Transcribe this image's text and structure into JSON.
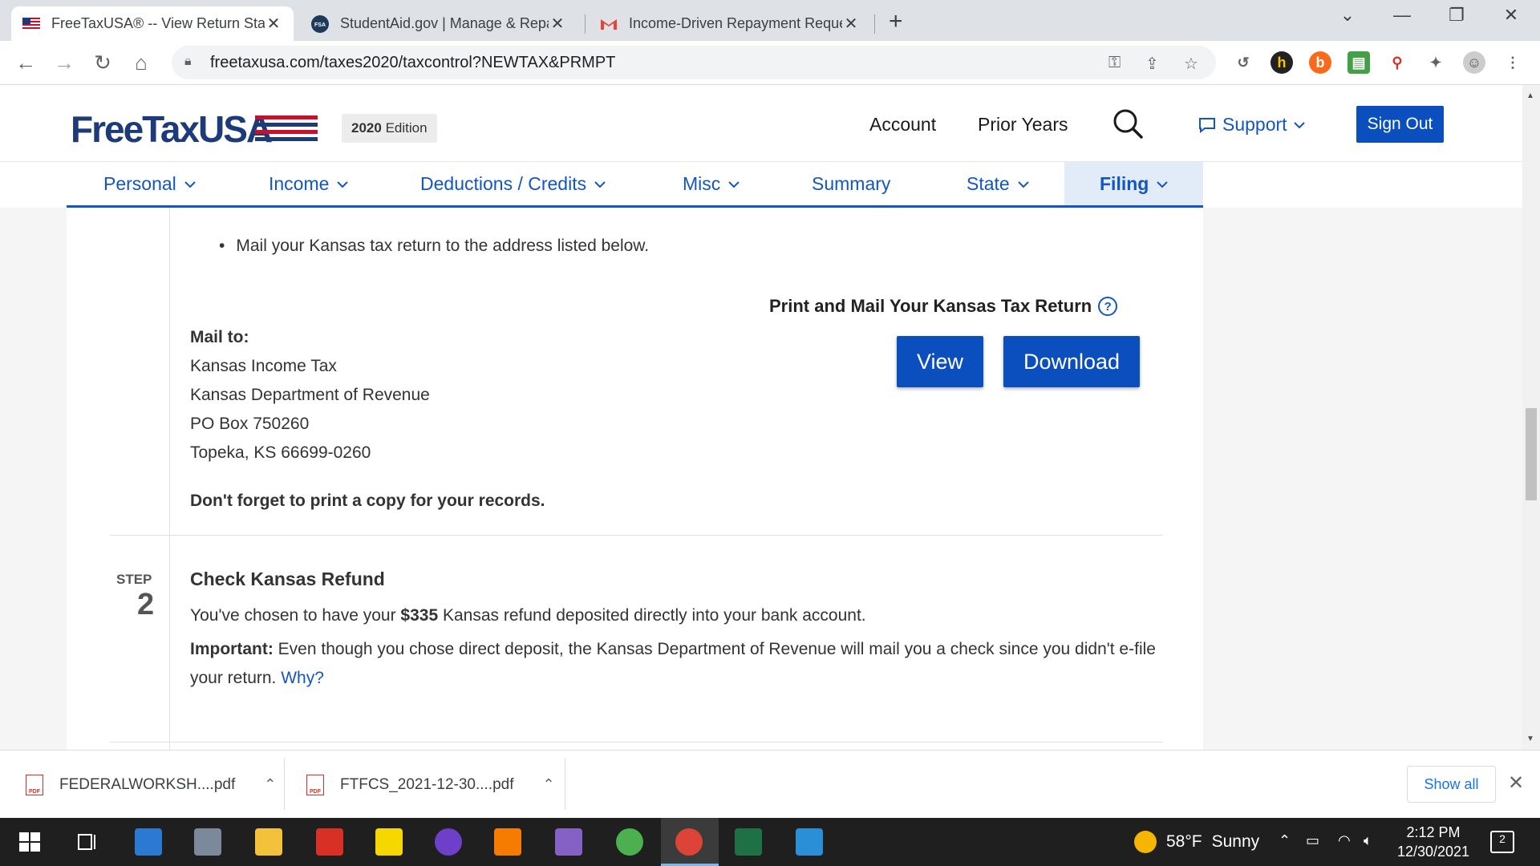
{
  "browser": {
    "tabs": [
      {
        "title": "FreeTaxUSA® -- View Return Stat",
        "active": true
      },
      {
        "title": "StudentAid.gov | Manage & Repa",
        "active": false
      },
      {
        "title": "Income-Driven Repayment Reque",
        "active": false
      }
    ],
    "url": "freetaxusa.com/taxes2020/taxcontrol?NEWTAX&PRMPT"
  },
  "site": {
    "logo": "FreeTaxUSA",
    "edition_year": "2020",
    "edition_word": "Edition",
    "header_links": [
      "Account",
      "Prior Years"
    ],
    "support": "Support",
    "sign_out": "Sign Out"
  },
  "nav": [
    {
      "label": "Personal",
      "dropdown": true
    },
    {
      "label": "Income",
      "dropdown": true
    },
    {
      "label": "Deductions / Credits",
      "dropdown": true
    },
    {
      "label": "Misc",
      "dropdown": true
    },
    {
      "label": "Summary",
      "dropdown": false
    },
    {
      "label": "State",
      "dropdown": true
    },
    {
      "label": "Filing",
      "dropdown": true,
      "active": true
    }
  ],
  "content": {
    "bullet": "Mail your Kansas tax return to the address listed below.",
    "print_title": "Print and Mail Your Kansas Tax Return",
    "view_button": "View",
    "download_button": "Download",
    "mail_to_label": "Mail to:",
    "address": [
      "Kansas Income Tax",
      "Kansas Department of Revenue",
      "PO Box 750260",
      "Topeka, KS  66699-0260"
    ],
    "reminder": "Don't forget to print a copy for your records.",
    "step2": {
      "step_label": "STEP",
      "step_number": "2",
      "title": "Check Kansas Refund",
      "refund_pre": "You've chosen to have your ",
      "refund_amount": "$335",
      "refund_post": " Kansas refund deposited directly into your bank account.",
      "important_label": "Important:",
      "important_text": " Even though you chose direct deposit, the Kansas Department of Revenue will mail you a check since you didn't e-file your return. ",
      "why_link": "Why?"
    }
  },
  "downloads": {
    "items": [
      "FEDERALWORKSH....pdf",
      "FTFCS_2021-12-30....pdf"
    ],
    "show_all": "Show all"
  },
  "taskbar": {
    "weather_temp": "58°F",
    "weather_desc": "Sunny",
    "time": "2:12 PM",
    "date": "12/30/2021",
    "notifications": "2"
  },
  "colors": {
    "brand_blue": "#0b4fbf",
    "link_blue": "#1256c4",
    "logo_navy": "#1d3a7a",
    "logo_red": "#c8102e",
    "active_nav_bg": "#e2ebf8"
  }
}
